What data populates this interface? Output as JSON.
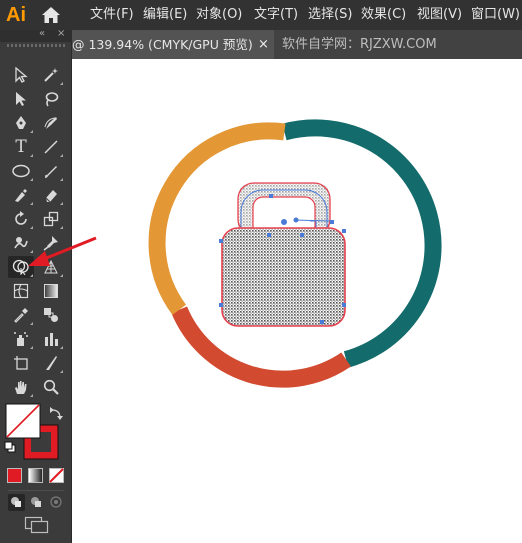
{
  "app": {
    "logo_text": "Ai"
  },
  "menu": [
    {
      "label": "文件(F)"
    },
    {
      "label": "编辑(E)"
    },
    {
      "label": "对象(O)"
    },
    {
      "label": "文字(T)"
    },
    {
      "label": "选择(S)"
    },
    {
      "label": "效果(C)"
    },
    {
      "label": "视图(V)"
    },
    {
      "label": "窗口(W)"
    }
  ],
  "tabs": {
    "document_title": "@ 139.94% (CMYK/GPU 预览)",
    "close_glyph": "×",
    "site_label": "软件自学网：RJZXW.COM"
  },
  "toolbar": {
    "collapse_glyph": "«",
    "close_glyph": "×",
    "tools": [
      {
        "name": "selection-tool-icon"
      },
      {
        "name": "magic-wand-tool-icon"
      },
      {
        "name": "direct-selection-tool-icon"
      },
      {
        "name": "lasso-tool-icon"
      },
      {
        "name": "pen-tool-icon"
      },
      {
        "name": "curvature-tool-icon"
      },
      {
        "name": "type-tool-icon",
        "glyph": "T"
      },
      {
        "name": "line-segment-tool-icon"
      },
      {
        "name": "ellipse-tool-icon"
      },
      {
        "name": "paintbrush-tool-icon"
      },
      {
        "name": "shaper-tool-icon"
      },
      {
        "name": "eraser-tool-icon"
      },
      {
        "name": "rotate-tool-icon"
      },
      {
        "name": "scale-tool-icon"
      },
      {
        "name": "warp-tool-icon"
      },
      {
        "name": "puppet-warp-tool-icon"
      },
      {
        "name": "shape-builder-tool-icon"
      },
      {
        "name": "perspective-grid-tool-icon"
      },
      {
        "name": "mesh-tool-icon"
      },
      {
        "name": "gradient-tool-icon"
      },
      {
        "name": "eyedropper-tool-icon"
      },
      {
        "name": "blend-tool-icon"
      },
      {
        "name": "symbol-sprayer-tool-icon"
      },
      {
        "name": "column-graph-tool-icon"
      },
      {
        "name": "artboard-tool-icon"
      },
      {
        "name": "slice-tool-icon"
      },
      {
        "name": "hand-tool-icon"
      },
      {
        "name": "zoom-tool-icon"
      }
    ]
  },
  "colors": {
    "fill": "#ffffff",
    "stroke": "#e01b24",
    "ring_orange": "#e39735",
    "ring_teal": "#136b6b",
    "ring_red": "#d24a30",
    "selection_red": "#e8414f",
    "anchor_blue": "#4a7bd8",
    "ui_dark": "#323232"
  }
}
